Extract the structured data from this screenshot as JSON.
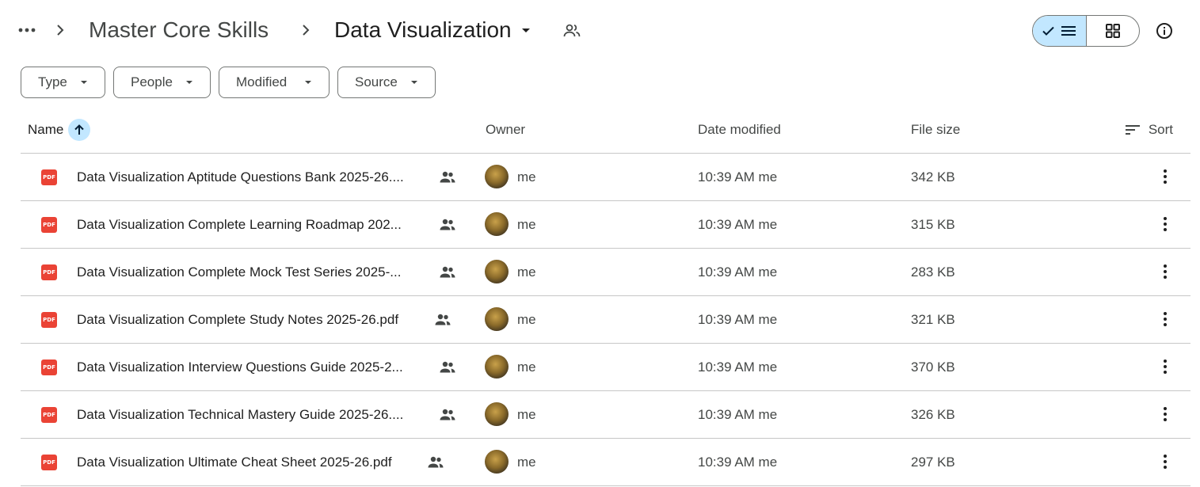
{
  "breadcrumb": {
    "parent": "Master Core Skills",
    "current": "Data Visualization"
  },
  "filters": [
    {
      "label": "Type"
    },
    {
      "label": "People"
    },
    {
      "label": "Modified"
    },
    {
      "label": "Source"
    }
  ],
  "table": {
    "columns": {
      "name": "Name",
      "owner": "Owner",
      "modified": "Date modified",
      "size": "File size"
    },
    "sort_label": "Sort",
    "rows": [
      {
        "name": "Data Visualization Aptitude Questions Bank 2025-26....",
        "owner": "me",
        "modified": "10:39 AM me",
        "size": "342 KB"
      },
      {
        "name": "Data Visualization Complete Learning Roadmap 202...",
        "owner": "me",
        "modified": "10:39 AM me",
        "size": "315 KB"
      },
      {
        "name": "Data Visualization Complete Mock Test Series 2025-...",
        "owner": "me",
        "modified": "10:39 AM me",
        "size": "283 KB"
      },
      {
        "name": "Data Visualization Complete Study Notes 2025-26.pdf",
        "owner": "me",
        "modified": "10:39 AM me",
        "size": "321 KB"
      },
      {
        "name": "Data Visualization Interview Questions Guide 2025-2...",
        "owner": "me",
        "modified": "10:39 AM me",
        "size": "370 KB"
      },
      {
        "name": "Data Visualization Technical Mastery Guide 2025-26....",
        "owner": "me",
        "modified": "10:39 AM me",
        "size": "326 KB"
      },
      {
        "name": "Data Visualization Ultimate Cheat Sheet 2025-26.pdf",
        "owner": "me",
        "modified": "10:39 AM me",
        "size": "297 KB"
      }
    ]
  },
  "icons": {
    "file_type": "pdf-icon",
    "file_badge": "PDF",
    "shared": "people-icon",
    "sort_direction": "arrow-up-icon"
  },
  "colors": {
    "accent_light": "#c2e7ff",
    "pdf_red": "#ea4335",
    "divider": "#c7c7c7"
  }
}
